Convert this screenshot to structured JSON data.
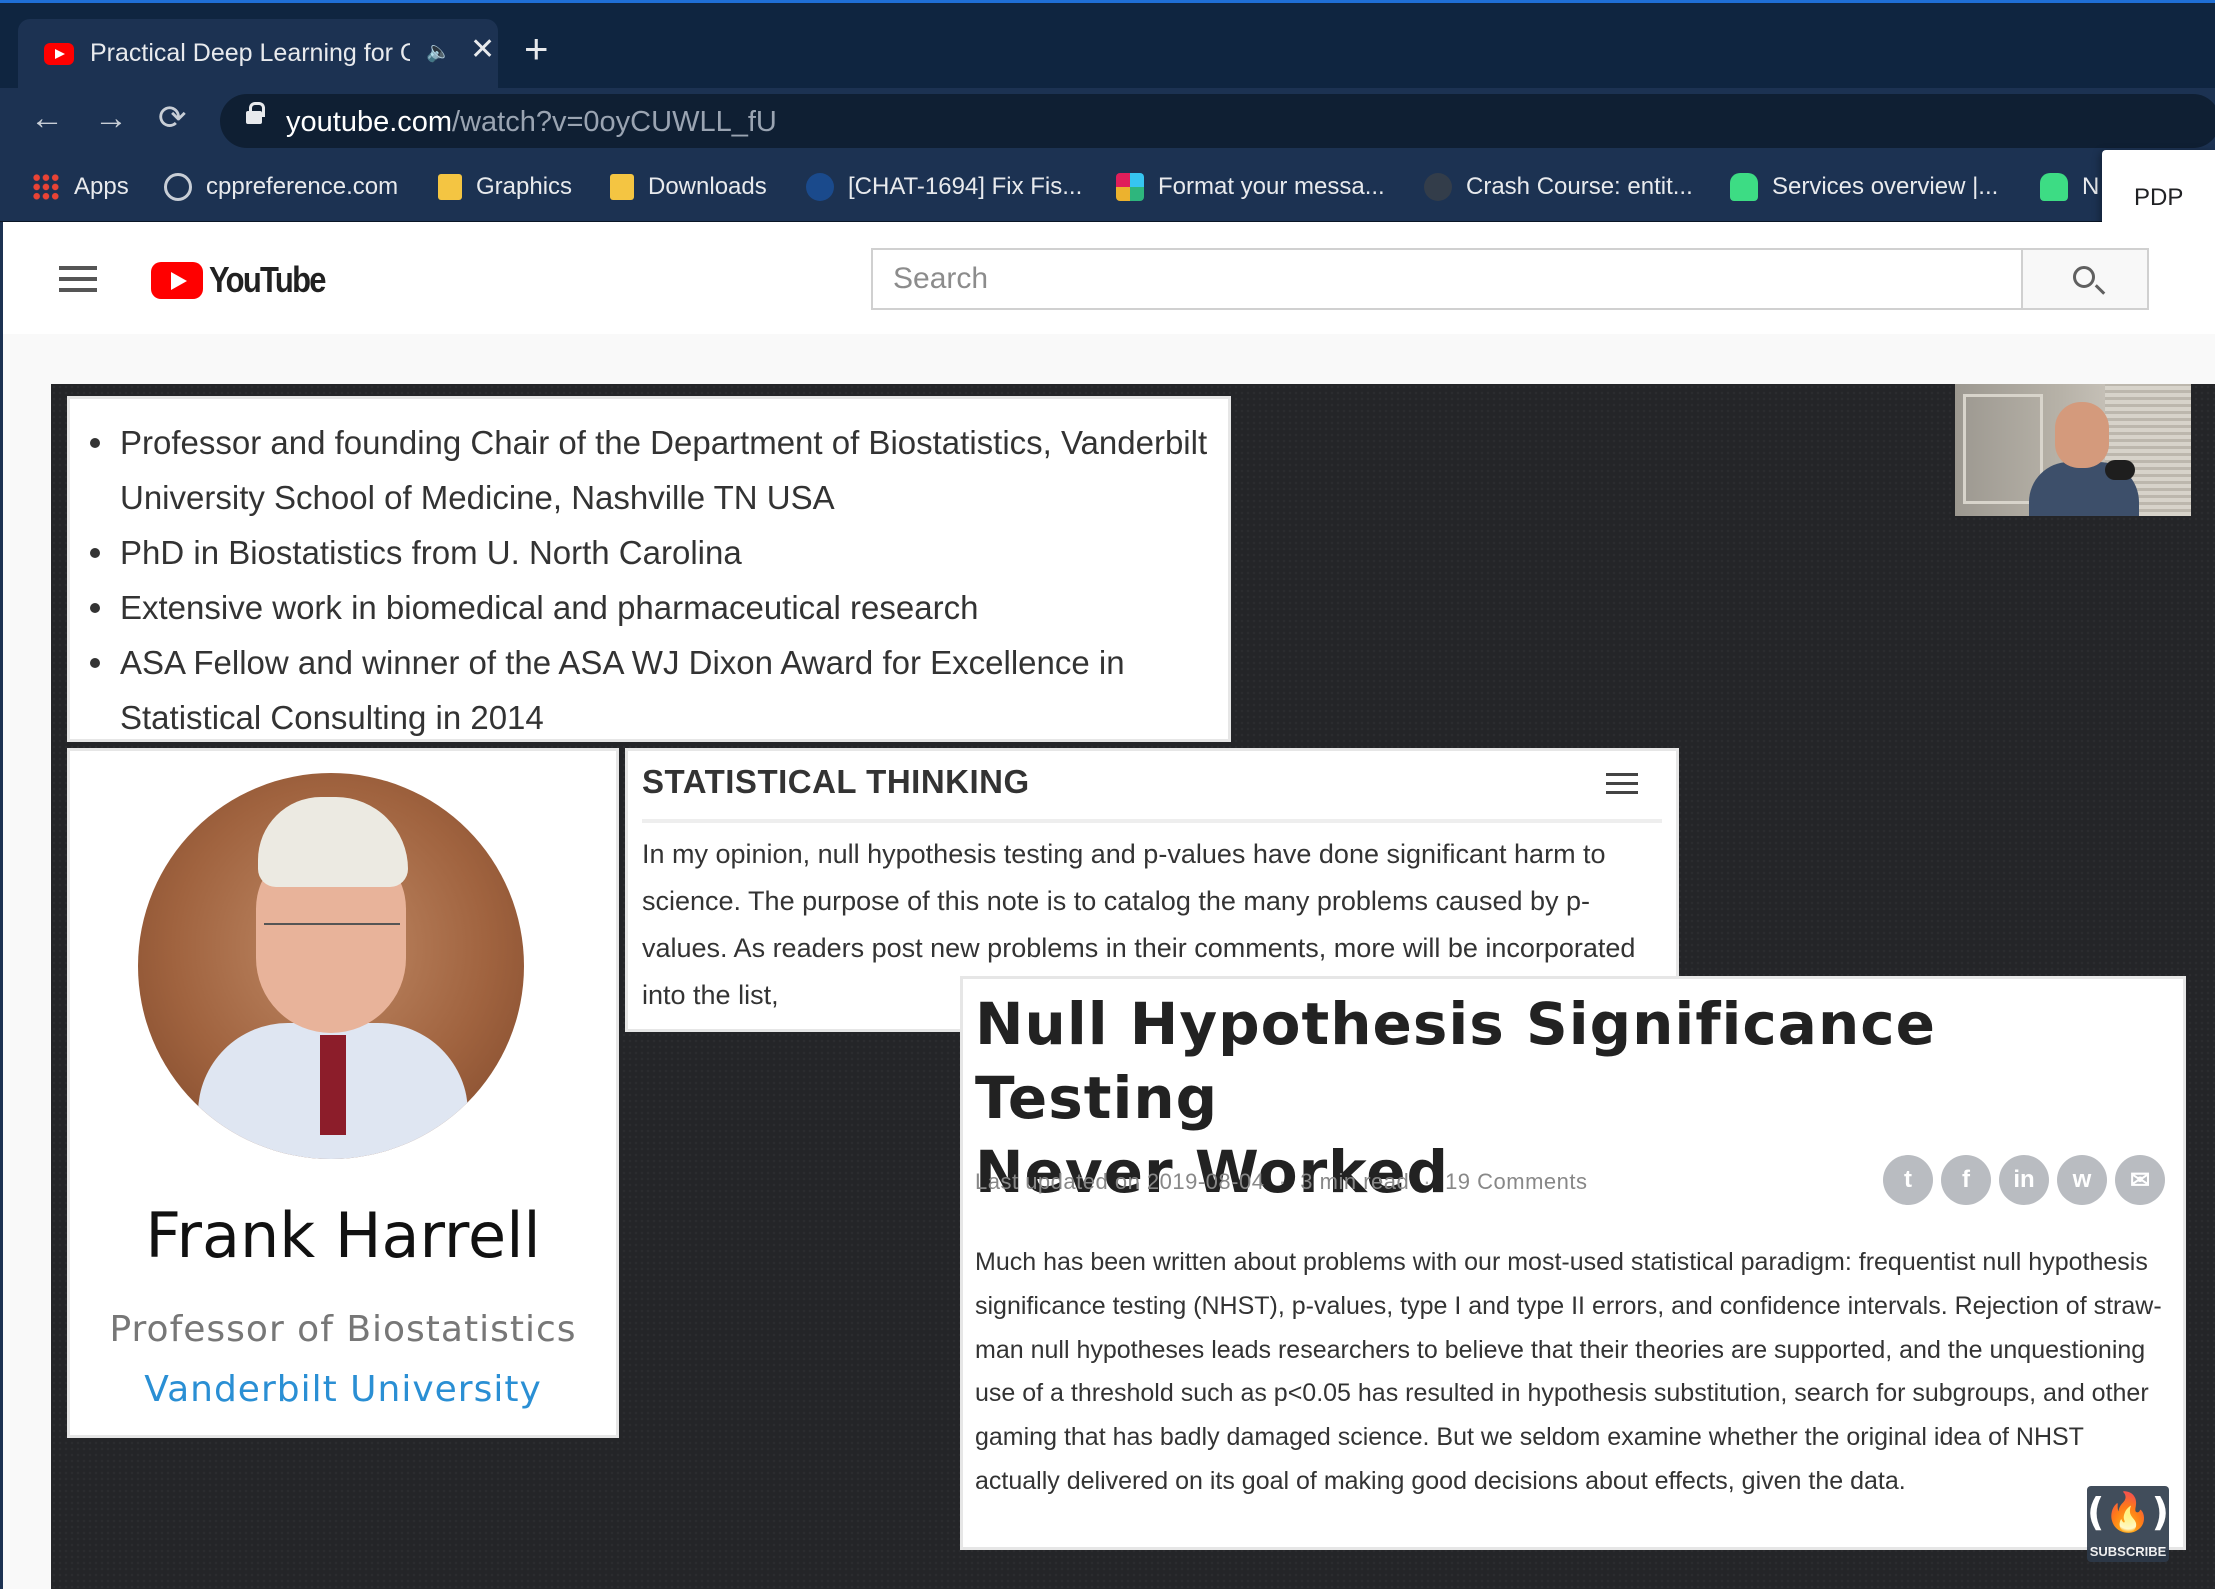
{
  "browser": {
    "tab": {
      "title": "Practical Deep Learning for C",
      "close_glyph": "✕",
      "audio_glyph": "🔈"
    },
    "new_tab_glyph": "+",
    "nav": {
      "back": "←",
      "forward": "→",
      "reload": "⟳"
    },
    "url": {
      "host": "youtube.com",
      "path": "/watch?v=0oyCUWLL_fU"
    },
    "bookmarks": [
      {
        "label": "Apps",
        "icon": "apps-grid-icon"
      },
      {
        "label": "cppreference.com",
        "icon": "cppreference-icon"
      },
      {
        "label": "Graphics",
        "icon": "folder-icon"
      },
      {
        "label": "Downloads",
        "icon": "folder-icon"
      },
      {
        "label": "[CHAT-1694] Fix Fis...",
        "icon": "ribbon-icon"
      },
      {
        "label": "Format your messa...",
        "icon": "slack-icon"
      },
      {
        "label": "Crash Course: entit...",
        "icon": "github-icon"
      },
      {
        "label": "Services overview |...",
        "icon": "android-icon"
      },
      {
        "label": "N",
        "icon": "android-icon"
      }
    ],
    "popup": {
      "label": "PDP"
    }
  },
  "youtube": {
    "logo_text": "YouTube",
    "search": {
      "placeholder": "Search"
    }
  },
  "video": {
    "bio": {
      "items": [
        {
          "line1": "Professor and founding Chair of the Department of Biostatistics, Vanderbilt",
          "line2": "University School of Medicine, Nashville TN USA"
        },
        {
          "line1": "PhD in Biostatistics from U. North Carolina",
          "line2": ""
        },
        {
          "line1": "Extensive work in biomedical and pharmaceutical research",
          "line2": ""
        },
        {
          "line1": "ASA Fellow and winner of the ASA WJ Dixon Award for Excellence in",
          "line2": "Statistical Consulting in 2014"
        }
      ]
    },
    "profile": {
      "name": "Frank Harrell",
      "title": "Professor of Biostatistics",
      "organization": "Vanderbilt University"
    },
    "stat_thinking": {
      "header": "STATISTICAL THINKING",
      "body": "In my opinion, null hypothesis testing and p-values have done significant harm to science. The purpose of this note is to catalog the many problems caused by p-values. As readers post new problems in their comments, more will be incorporated into the list,"
    },
    "article": {
      "title_line1": "Null Hypothesis Significance Testing",
      "title_line2": "Never Worked",
      "updated": "Last updated on 2019-08-04",
      "read_time": "3 min read",
      "comments": "19 Comments",
      "share_icons": [
        "twitter-icon",
        "facebook-icon",
        "linkedin-icon",
        "weibo-icon",
        "email-icon"
      ],
      "body": "Much has been written about problems with our most-used statistical paradigm: frequentist null hypothesis significance testing (NHST), p-values, type I and type II errors, and confidence intervals. Rejection of straw-man null hypotheses leads researchers to believe that their theories are supported, and the unquestioning use of a threshold such as p<0.05 has resulted in hypothesis substitution, search for subgroups, and other gaming that has badly damaged science. But we seldom examine whether the original idea of NHST actually delivered on its goal of making good decisions about effects, given the data."
    },
    "subscribe_label": "SUBSCRIBE"
  }
}
